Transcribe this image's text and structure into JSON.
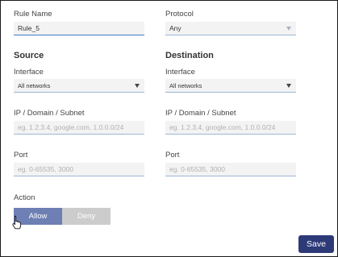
{
  "rule_name": {
    "label": "Rule Name",
    "value": "Rule_5"
  },
  "protocol": {
    "label": "Protocol",
    "value": "Any"
  },
  "source": {
    "heading": "Source",
    "interface_label": "Interface",
    "interface_value": "All networks",
    "ip_label": "IP / Domain / Subnet",
    "ip_placeholder": "eg. 1.2.3.4, google.com, 1.0.0.0/24",
    "port_label": "Port",
    "port_placeholder": "eg. 0-65535, 3000"
  },
  "destination": {
    "heading": "Destination",
    "interface_label": "Interface",
    "interface_value": "All networks",
    "ip_label": "IP / Domain / Subnet",
    "ip_placeholder": "eg. 1.2.3.4, google.com, 1.0.0.0/24",
    "port_label": "Port",
    "port_placeholder": "eg. 0-65535, 3000"
  },
  "action": {
    "label": "Action",
    "allow_label": "Allow",
    "deny_label": "Deny",
    "selected": "Allow"
  },
  "save_label": "Save",
  "colors": {
    "accent": "#3f79c4",
    "allow_active": "#6e7fb4",
    "deny_inactive": "#cccccc",
    "save": "#2e3a78"
  }
}
